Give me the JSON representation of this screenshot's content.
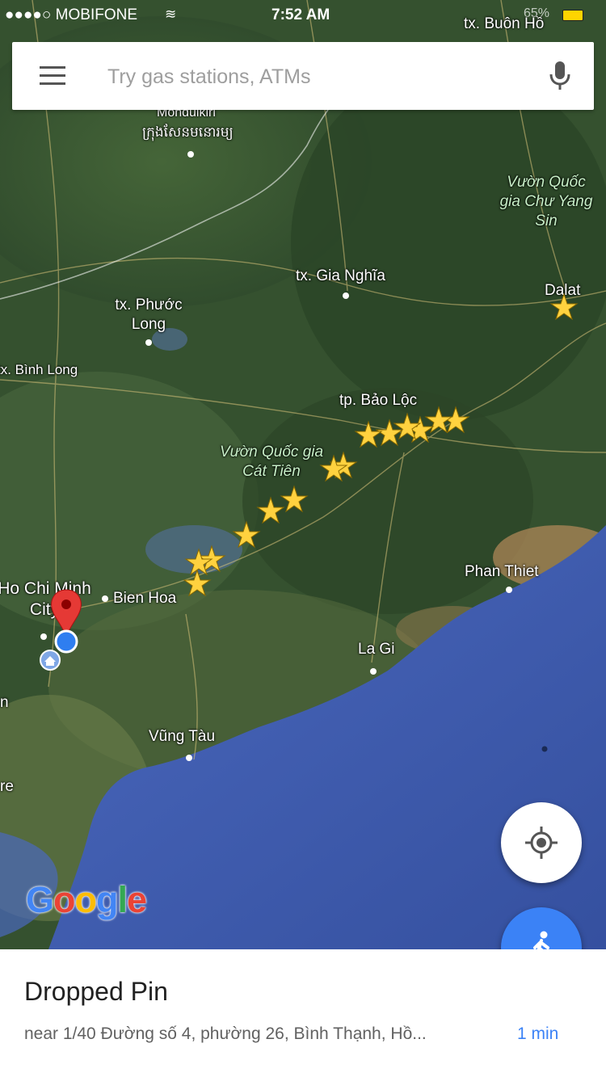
{
  "status_bar": {
    "signal": "●●●●○",
    "carrier": "MOBIFONE",
    "time": "7:52 AM",
    "battery_text": "65%",
    "battery_color": "#ffd400"
  },
  "search": {
    "placeholder": "Try gas stations, ATMs",
    "menu_icon": "hamburger-menu-icon",
    "mic_icon": "microphone-icon"
  },
  "map": {
    "labels": {
      "buon_ho": "tx. Buôn Hồ",
      "mondulkiri": "Mondulkiri",
      "mondulkiri_khmer": "ក្រុងសែនមនោរម្យ",
      "chu_yang_sin": "Vườn Quốc gia Chư Yang Sin",
      "gia_nghia": "tx. Gia Nghĩa",
      "phuoc_long": "tx. Phước Long",
      "dalat": "Dalat",
      "binh_long": "tx. Bình Long",
      "bao_loc": "tp. Bảo Lộc",
      "cat_tien": "Vườn Quốc gia Cát Tiên",
      "ho_chi_minh": "Ho Chi Minh City",
      "bien_hoa": "Bien Hoa",
      "phan_thiet": "Phan Thiet",
      "la_gi": "La Gi",
      "vung_tau": "Vũng Tàu",
      "edge_n": "n",
      "edge_re": "re"
    },
    "marker_icon": "star-icon",
    "pin_icon": "red-pin-icon",
    "location_icon": "blue-dot-icon",
    "home_icon": "home-icon",
    "sea_color": "#3e5bb0",
    "land_color": "#3b5a35",
    "star_color": "#ffd23f"
  },
  "logo": {
    "text": "Google"
  },
  "fabs": {
    "locate_icon": "my-location-icon",
    "walk_icon": "walking-icon"
  },
  "sheet": {
    "title": "Dropped Pin",
    "address": "near 1/40 Đường số 4, phường 26, Bình Thạnh, Hồ...",
    "eta": "1 min"
  }
}
